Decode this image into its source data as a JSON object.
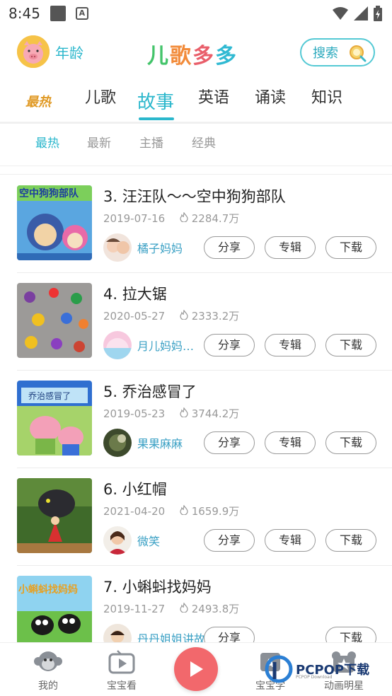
{
  "status_bar": {
    "time": "8:45"
  },
  "header": {
    "age_label": "年龄",
    "logo_chars": [
      "儿",
      "歌",
      "多",
      "多"
    ],
    "search_label": "搜索"
  },
  "main_tabs": {
    "hot": "最热",
    "items": [
      "儿歌",
      "故事",
      "英语",
      "诵读",
      "知识"
    ],
    "active": "故事"
  },
  "sub_tabs": {
    "items": [
      "最热",
      "最新",
      "主播",
      "经典"
    ],
    "active": "最热"
  },
  "actions": {
    "share": "分享",
    "album": "专辑",
    "download": "下载"
  },
  "stories": [
    {
      "title": "3. 汪汪队～～空中狗狗部队",
      "date": "2019-07-16",
      "plays": "2284.7万",
      "author": "橘子妈妈",
      "thumb_text": "空中狗狗部队"
    },
    {
      "title": "4. 拉大锯",
      "date": "2020-05-27",
      "plays": "2333.2万",
      "author": "月儿妈妈讲故事",
      "thumb_text": ""
    },
    {
      "title": "5. 乔治感冒了",
      "date": "2019-05-23",
      "plays": "3744.2万",
      "author": "果果麻麻",
      "thumb_text": "乔治感冒了"
    },
    {
      "title": "6. 小红帽",
      "date": "2021-04-20",
      "plays": "1659.9万",
      "author": "微笑",
      "thumb_text": ""
    },
    {
      "title": "7. 小蝌蚪找妈妈",
      "date": "2019-11-27",
      "plays": "2493.8万",
      "author": "丹丹姐姐讲故事",
      "thumb_text": "小蝌蚪找妈妈"
    }
  ],
  "bottom_nav": {
    "mine": "我的",
    "watch": "宝宝看",
    "learn": "宝宝学",
    "stars": "动画明星"
  },
  "watermark": {
    "brand": "PCPOP下载",
    "sub": "PCPOP Download"
  },
  "colors": {
    "accent": "#2bb7cc",
    "play": "#f2686c",
    "hot": "#e09a26"
  }
}
